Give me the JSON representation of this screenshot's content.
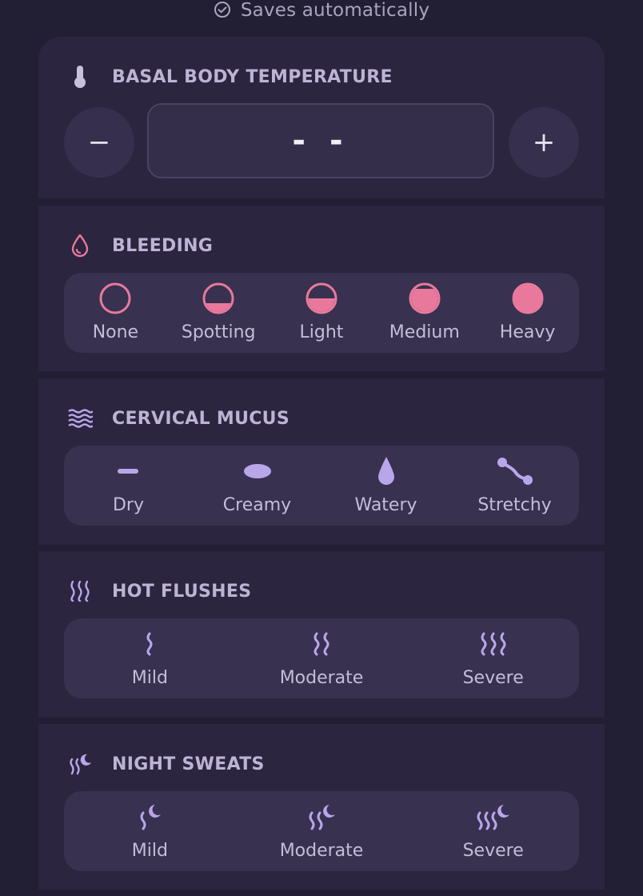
{
  "status": {
    "text": "Saves automatically",
    "icon": "check-circle-icon"
  },
  "colors": {
    "background": "#221e33",
    "card": "#2b253f",
    "option_group": "#383150",
    "pink": "#e8799c",
    "lavender": "#b9a6ea",
    "label": "#bdb3d4"
  },
  "temperature": {
    "title": "BASAL BODY TEMPERATURE",
    "icon": "thermometer-icon",
    "value": "- -",
    "decrease_label": "−",
    "increase_label": "+"
  },
  "bleeding": {
    "title": "BLEEDING",
    "icon": "drop-icon",
    "options": [
      {
        "label": "None",
        "icon": "circle-empty-icon",
        "fill": 0
      },
      {
        "label": "Spotting",
        "icon": "circle-quarter-icon",
        "fill": 0.25
      },
      {
        "label": "Light",
        "icon": "circle-half-icon",
        "fill": 0.5
      },
      {
        "label": "Medium",
        "icon": "circle-mostly-icon",
        "fill": 0.8
      },
      {
        "label": "Heavy",
        "icon": "circle-full-icon",
        "fill": 1
      }
    ]
  },
  "mucus": {
    "title": "CERVICAL MUCUS",
    "icon": "waves-icon",
    "options": [
      {
        "label": "Dry",
        "icon": "dash-icon"
      },
      {
        "label": "Creamy",
        "icon": "oval-icon"
      },
      {
        "label": "Watery",
        "icon": "droplet-icon"
      },
      {
        "label": "Stretchy",
        "icon": "stretch-icon"
      }
    ]
  },
  "flushes": {
    "title": "HOT FLUSHES",
    "icon": "heat-waves-icon",
    "options": [
      {
        "label": "Mild",
        "icon": "heat-1-icon",
        "level": 1
      },
      {
        "label": "Moderate",
        "icon": "heat-2-icon",
        "level": 2
      },
      {
        "label": "Severe",
        "icon": "heat-3-icon",
        "level": 3
      }
    ]
  },
  "sweats": {
    "title": "NIGHT SWEATS",
    "icon": "heat-moon-icon",
    "options": [
      {
        "label": "Mild",
        "icon": "sweat-1-icon",
        "level": 1
      },
      {
        "label": "Moderate",
        "icon": "sweat-2-icon",
        "level": 2
      },
      {
        "label": "Severe",
        "icon": "sweat-3-icon",
        "level": 3
      }
    ]
  }
}
